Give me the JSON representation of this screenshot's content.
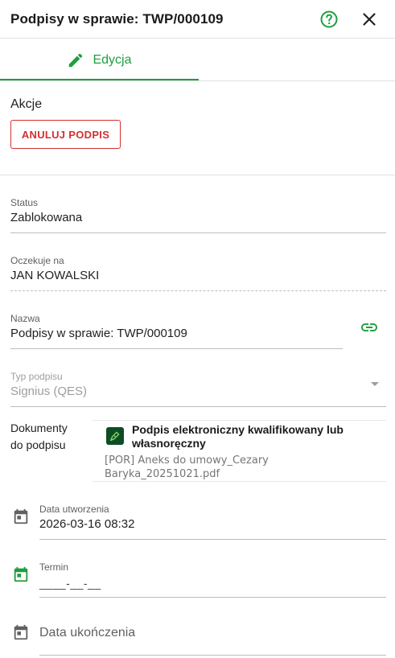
{
  "header": {
    "title": "Podpisy w sprawie: TWP/000109"
  },
  "tabs": [
    {
      "label": "Edycja",
      "icon": "pencil-icon",
      "active": true
    }
  ],
  "actions": {
    "title": "Akcje",
    "cancel_label": "ANULUJ PODPIS"
  },
  "fields": {
    "status": {
      "label": "Status",
      "value": "Zablokowana"
    },
    "awaiting": {
      "label": "Oczekuje na",
      "value": "JAN KOWALSKI"
    },
    "name": {
      "label": "Nazwa",
      "value": "Podpisy w sprawie: TWP/000109"
    },
    "signature_type": {
      "label": "Typ podpisu",
      "value": "Signius (QES)"
    }
  },
  "documents": {
    "label_line1": "Dokumenty",
    "label_line2": "do podpisu",
    "items": [
      {
        "title": "Podpis elektroniczny kwalifikowany lub własnoręczny",
        "file": "[POR] Aneks do umowy_Cezary Baryka_20251021.pdf"
      }
    ]
  },
  "dates": {
    "created": {
      "label": "Data utworzenia",
      "value": "2026-03-16 08:32"
    },
    "deadline": {
      "label": "Termin",
      "value": "____-__-__"
    },
    "completed": {
      "placeholder": "Data ukończenia"
    }
  },
  "colors": {
    "accent": "#1e9e3e",
    "danger": "#d32f2f"
  }
}
